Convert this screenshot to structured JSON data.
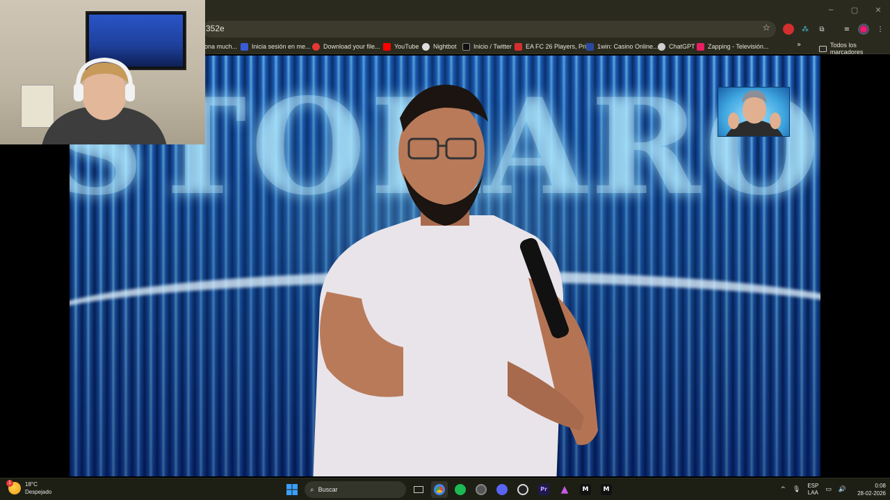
{
  "window": {
    "minimize_glyph": "─",
    "maximize_glyph": "▢",
    "close_glyph": "✕"
  },
  "browser": {
    "url": "352e",
    "bookmark_star": "☆",
    "bookmarks": [
      {
        "label": "ona much...",
        "color": "#6d6d6d"
      },
      {
        "label": "Inicia sesión en me...",
        "color": "#3a5bd6"
      },
      {
        "label": "Download your file...",
        "color": "#e53935"
      },
      {
        "label": "YouTube",
        "color": "#ff0000"
      },
      {
        "label": "Nightbot",
        "color": "#dddddd"
      },
      {
        "label": "Inicio / Twitter",
        "color": "#111111"
      },
      {
        "label": "EA FC 26 Players, Pri...",
        "color": "#d32f2f"
      },
      {
        "label": "1win: Casino Online...",
        "color": "#2a4a9e"
      },
      {
        "label": "ChatGPT",
        "color": "#cfcfcf"
      },
      {
        "label": "Zapping - Televisión...",
        "color": "#e91e63"
      }
    ],
    "bookmarks_overflow": "»",
    "all_bookmarks": "Todos los marcadores"
  },
  "taskbar": {
    "weather": {
      "temp": "18°C",
      "condition": "Despejado",
      "badge": "1"
    },
    "search_label": "Buscar",
    "language": {
      "line1": "ESP",
      "line2": "LAA"
    },
    "time": "0:08",
    "date": "28-02-2026"
  }
}
